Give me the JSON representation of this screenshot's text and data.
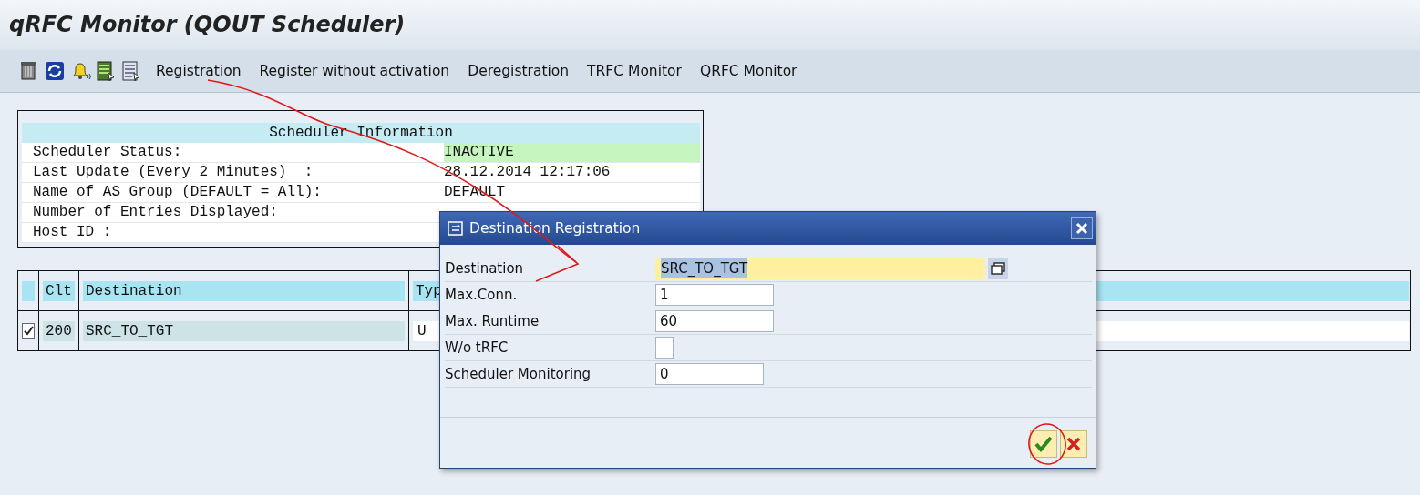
{
  "window": {
    "title": "qRFC Monitor (QOUT Scheduler)"
  },
  "toolbar": {
    "buttons": [
      "Registration",
      "Register without activation",
      "Deregistration",
      "TRFC Monitor",
      "QRFC Monitor"
    ]
  },
  "scheduler_info": {
    "title": "Scheduler Information",
    "rows": [
      {
        "label": "Scheduler Status:",
        "value": "INACTIVE",
        "color": "#c6f5c0"
      },
      {
        "label": "Last Update (Every 2 Minutes)  :",
        "value": "28.12.2014 12:17:06"
      },
      {
        "label": "Name of AS Group (DEFAULT = All):",
        "value": "DEFAULT"
      },
      {
        "label": "Number of Entries Displayed:"
      },
      {
        "label": "Host ID :"
      }
    ]
  },
  "destinations_table": {
    "columns": [
      "Clt",
      "Destination",
      "Typ"
    ],
    "rows": [
      {
        "selected": true,
        "cells": [
          "200",
          "SRC_TO_TGT",
          "U"
        ]
      }
    ]
  },
  "dialog": {
    "title": "Destination Registration",
    "fields": [
      {
        "label": "Destination",
        "kind": "text",
        "value": "SRC_TO_TGT",
        "focused": true
      },
      {
        "label": "Max.Conn.",
        "kind": "text",
        "value": "1",
        "focused": false
      },
      {
        "label": "Max. Runtime",
        "kind": "text",
        "value": "60",
        "focused": false
      },
      {
        "label": "W/o tRFC",
        "kind": "checkbox",
        "checked": false,
        "focused": false
      },
      {
        "label": "Scheduler Monitoring",
        "kind": "text",
        "value": "0",
        "focused": false
      }
    ]
  }
}
